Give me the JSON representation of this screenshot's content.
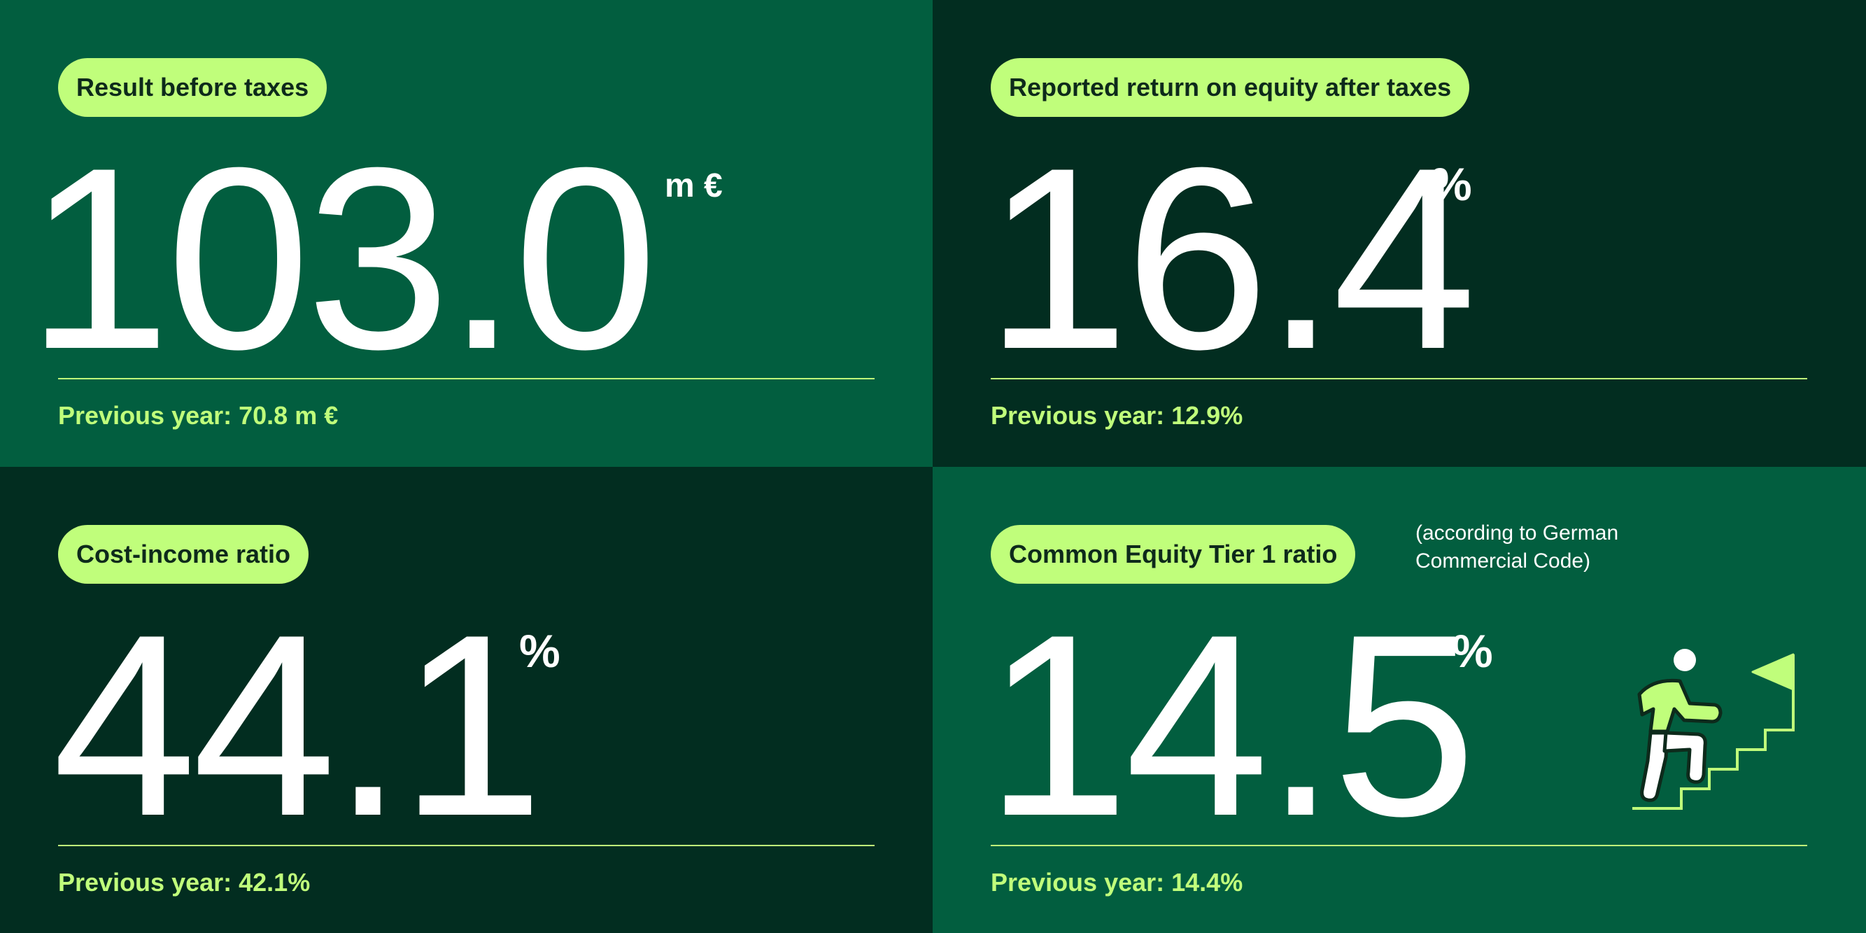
{
  "colors": {
    "panel_light": "#025e3f",
    "panel_dark": "#022d20",
    "accent": "#c0fe7b",
    "text": "#ffffff"
  },
  "kpis": [
    {
      "label": "Result before taxes",
      "value": "103.0",
      "unit": "m €",
      "previous": "Previous year: 70.8 m €"
    },
    {
      "label": "Reported return on equity after taxes",
      "value": "16.4",
      "unit": "%",
      "previous": "Previous year: 12.9%"
    },
    {
      "label": "Cost-income ratio",
      "value": "44.1",
      "unit": "%",
      "previous": "Previous year: 42.1%"
    },
    {
      "label": "Common Equity Tier 1 ratio",
      "value": "14.5",
      "unit": "%",
      "previous": "Previous year: 14.4%",
      "note_lines": [
        "(according to German",
        "Commercial Code)"
      ],
      "icon": "person-climbing-stairs-to-flag-icon"
    }
  ]
}
